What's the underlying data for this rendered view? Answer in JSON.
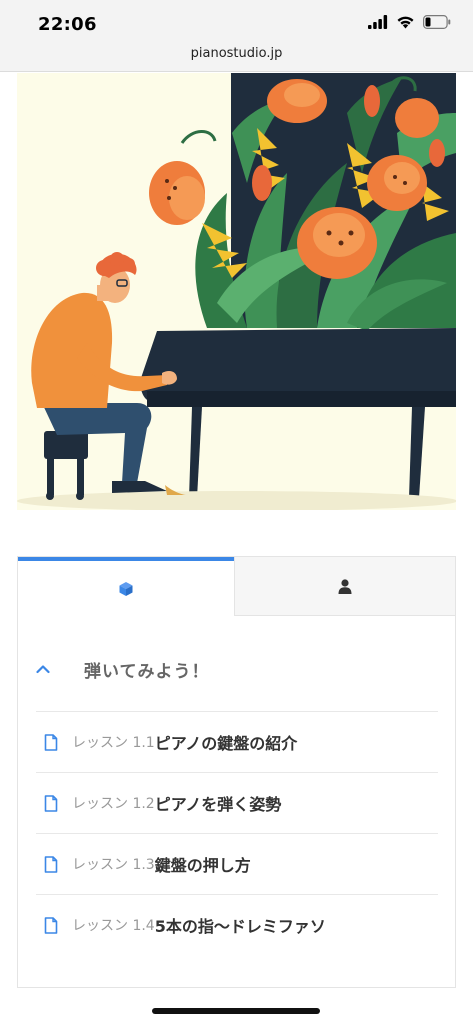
{
  "status": {
    "time": "22:06"
  },
  "browser": {
    "url": "pianostudio.jp"
  },
  "tabs": [
    {
      "name": "course",
      "icon": "cube-icon",
      "active": true
    },
    {
      "name": "profile",
      "icon": "user-icon",
      "active": false
    }
  ],
  "section": {
    "title": "弾いてみよう！",
    "expanded": true
  },
  "lessons": [
    {
      "prefix": "レッスン  1.1",
      "title": "ピアノの鍵盤の紹介"
    },
    {
      "prefix": "レッスン  1.2",
      "title": "ピアノを弾く姿勢"
    },
    {
      "prefix": "レッスン  1.3",
      "title": "鍵盤の押し方"
    },
    {
      "prefix": "レッスン  1.4",
      "title": "5本の指〜ドレミファソ"
    }
  ],
  "colors": {
    "accent": "#3b87e6",
    "hero_bg": "#fdfce8"
  }
}
